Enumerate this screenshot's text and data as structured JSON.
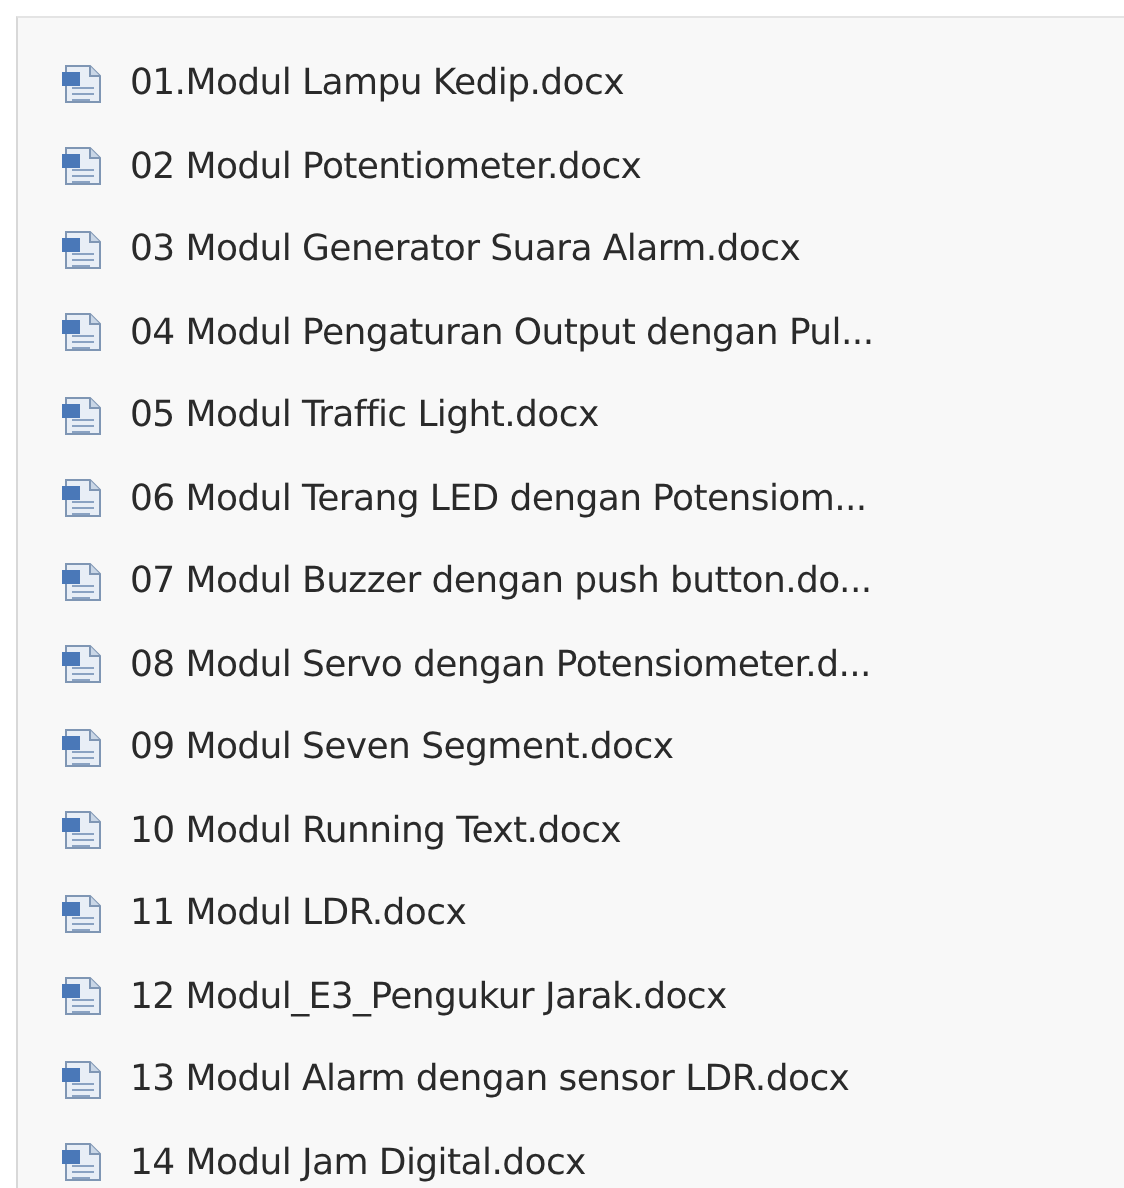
{
  "files": [
    {
      "name": "01.Modul Lampu Kedip.docx"
    },
    {
      "name": "02 Modul Potentiometer.docx"
    },
    {
      "name": "03 Modul Generator Suara Alarm.docx"
    },
    {
      "name": "04 Modul Pengaturan Output dengan Pul..."
    },
    {
      "name": "05 Modul Traffic Light.docx"
    },
    {
      "name": "06 Modul Terang LED dengan Potensiom..."
    },
    {
      "name": "07 Modul Buzzer dengan push button.do..."
    },
    {
      "name": "08 Modul Servo dengan Potensiometer.d..."
    },
    {
      "name": "09 Modul Seven Segment.docx"
    },
    {
      "name": "10 Modul Running Text.docx"
    },
    {
      "name": "11 Modul LDR.docx"
    },
    {
      "name": "12 Modul_E3_Pengukur Jarak.docx"
    },
    {
      "name": "13 Modul Alarm dengan sensor LDR.docx"
    },
    {
      "name": "14 Modul Jam Digital.docx"
    }
  ]
}
